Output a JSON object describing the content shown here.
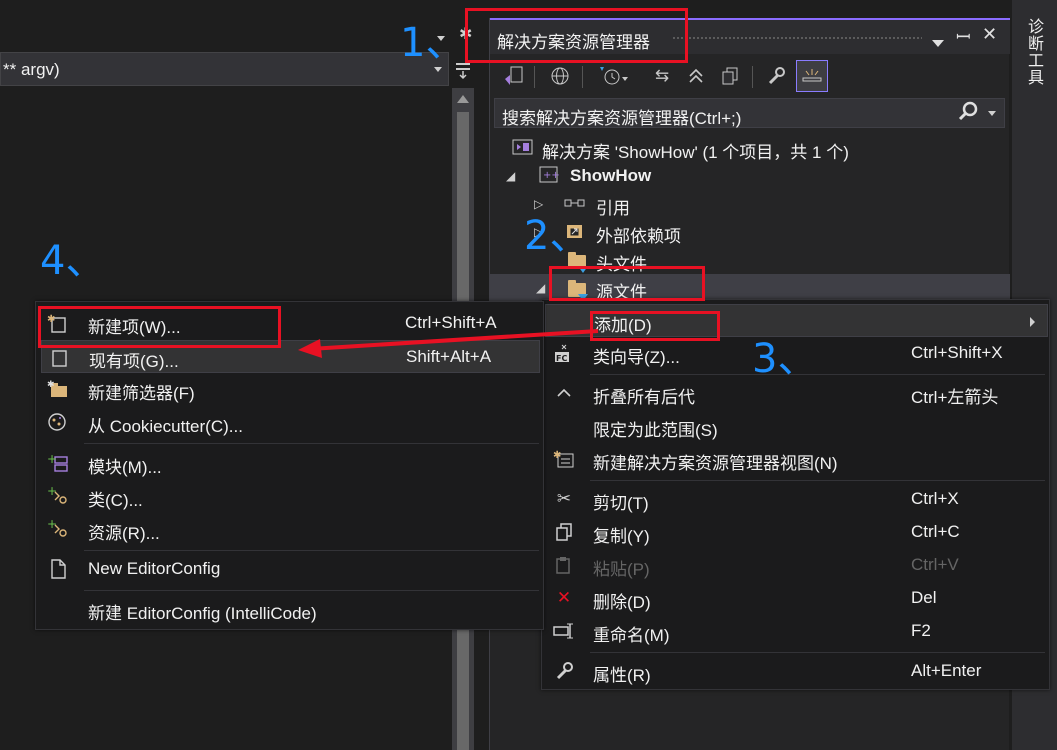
{
  "editor": {
    "nav_combo_text": "** argv)"
  },
  "solution_explorer": {
    "title": "解决方案资源管理器",
    "search_placeholder": "搜索解决方案资源管理器(Ctrl+;)",
    "tree": {
      "solution": "解决方案 'ShowHow' (1 个项目，共 1 个)",
      "project": "ShowHow",
      "references": "引用",
      "external_deps": "外部依赖项",
      "header_files": "头文件",
      "source_files": "源文件"
    }
  },
  "diagnostics_tab": "诊断工具",
  "context_menu": {
    "items": [
      {
        "label": "添加(D)",
        "shortcut": ""
      },
      {
        "label": "类向导(Z)...",
        "shortcut": "Ctrl+Shift+X"
      },
      {
        "label": "折叠所有后代",
        "shortcut": "Ctrl+左箭头"
      },
      {
        "label": "限定为此范围(S)",
        "shortcut": ""
      },
      {
        "label": "新建解决方案资源管理器视图(N)",
        "shortcut": ""
      },
      {
        "label": "剪切(T)",
        "shortcut": "Ctrl+X"
      },
      {
        "label": "复制(Y)",
        "shortcut": "Ctrl+C"
      },
      {
        "label": "粘贴(P)",
        "shortcut": "Ctrl+V"
      },
      {
        "label": "删除(D)",
        "shortcut": "Del"
      },
      {
        "label": "重命名(M)",
        "shortcut": "F2"
      },
      {
        "label": "属性(R)",
        "shortcut": "Alt+Enter"
      }
    ]
  },
  "add_submenu": {
    "items": [
      {
        "label": "新建项(W)...",
        "shortcut": "Ctrl+Shift+A"
      },
      {
        "label": "现有项(G)...",
        "shortcut": "Shift+Alt+A"
      },
      {
        "label": "新建筛选器(F)",
        "shortcut": ""
      },
      {
        "label": "从 Cookiecutter(C)...",
        "shortcut": ""
      },
      {
        "label": "模块(M)...",
        "shortcut": ""
      },
      {
        "label": "类(C)...",
        "shortcut": ""
      },
      {
        "label": "资源(R)...",
        "shortcut": ""
      },
      {
        "label": "New EditorConfig",
        "shortcut": ""
      },
      {
        "label": "新建 EditorConfig (IntelliCode)",
        "shortcut": ""
      }
    ]
  },
  "annotations": {
    "step1": "1、",
    "step2": "2、",
    "step3": "3、",
    "step4": "4、"
  },
  "colors": {
    "annotation_blue": "#1e90ff",
    "annotation_red": "#e81123",
    "accent_purple": "#8a6cff"
  }
}
